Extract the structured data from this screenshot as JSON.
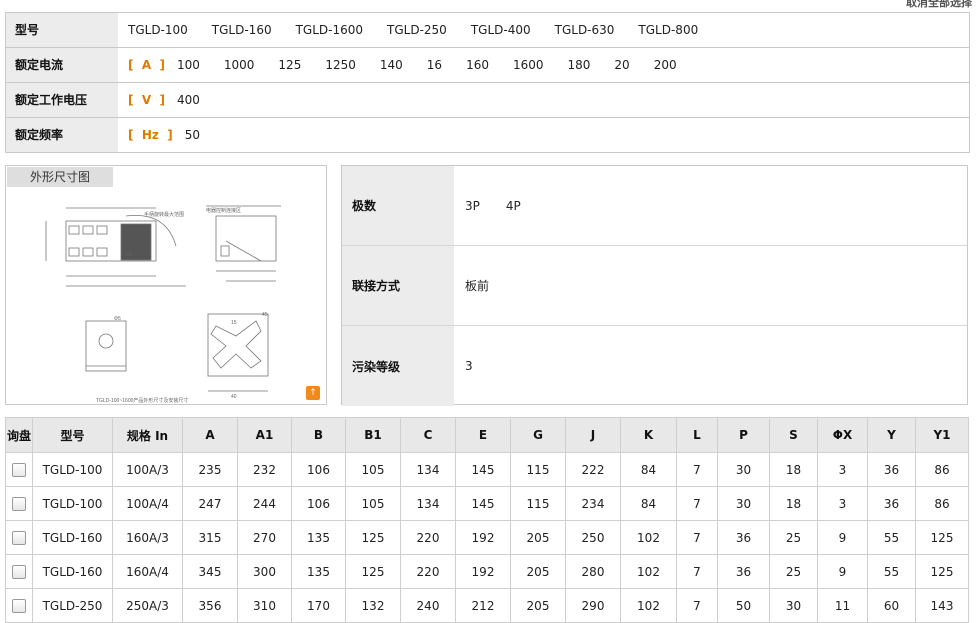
{
  "cancel_all": "取消全部选择",
  "filters": {
    "model": {
      "label": "型号",
      "options": [
        "TGLD-100",
        "TGLD-160",
        "TGLD-1600",
        "TGLD-250",
        "TGLD-400",
        "TGLD-630",
        "TGLD-800"
      ]
    },
    "current": {
      "label": "额定电流",
      "unit": "[  A  ]",
      "options": [
        "100",
        "1000",
        "125",
        "1250",
        "140",
        "16",
        "160",
        "1600",
        "180",
        "20",
        "200"
      ]
    },
    "voltage": {
      "label": "额定工作电压",
      "unit": "[  V  ]",
      "options": [
        "400"
      ]
    },
    "frequency": {
      "label": "额定频率",
      "unit": "[  Hz  ]",
      "options": [
        "50"
      ]
    }
  },
  "dimension_panel": {
    "tab": "外形尺寸图",
    "drawing_notes": [
      "手柄旋转最大范围",
      "电器控制连接区",
      "TGLD-100~1600产品外形尺寸及安装尺寸",
      "15",
      "40",
      "45",
      "Φ5",
      "50"
    ]
  },
  "attributes": [
    {
      "label": "极数",
      "values": [
        "3P",
        "4P"
      ]
    },
    {
      "label": "联接方式",
      "values": [
        "板前"
      ]
    },
    {
      "label": "污染等级",
      "values": [
        "3"
      ]
    }
  ],
  "table": {
    "headers": [
      "询盘",
      "型号",
      "规格 In",
      "A",
      "A1",
      "B",
      "B1",
      "C",
      "E",
      "G",
      "J",
      "K",
      "L",
      "P",
      "S",
      "ΦX",
      "Y",
      "Y1"
    ],
    "rows": [
      [
        "TGLD-100",
        "100A/3",
        "235",
        "232",
        "106",
        "105",
        "134",
        "145",
        "115",
        "222",
        "84",
        "7",
        "30",
        "18",
        "3",
        "36",
        "86"
      ],
      [
        "TGLD-100",
        "100A/4",
        "247",
        "244",
        "106",
        "105",
        "134",
        "145",
        "115",
        "234",
        "84",
        "7",
        "30",
        "18",
        "3",
        "36",
        "86"
      ],
      [
        "TGLD-160",
        "160A/3",
        "315",
        "270",
        "135",
        "125",
        "220",
        "192",
        "205",
        "250",
        "102",
        "7",
        "36",
        "25",
        "9",
        "55",
        "125"
      ],
      [
        "TGLD-160",
        "160A/4",
        "345",
        "300",
        "135",
        "125",
        "220",
        "192",
        "205",
        "280",
        "102",
        "7",
        "36",
        "25",
        "9",
        "55",
        "125"
      ],
      [
        "TGLD-250",
        "250A/3",
        "356",
        "310",
        "170",
        "132",
        "240",
        "212",
        "205",
        "290",
        "102",
        "7",
        "50",
        "30",
        "11",
        "60",
        "143"
      ]
    ]
  }
}
